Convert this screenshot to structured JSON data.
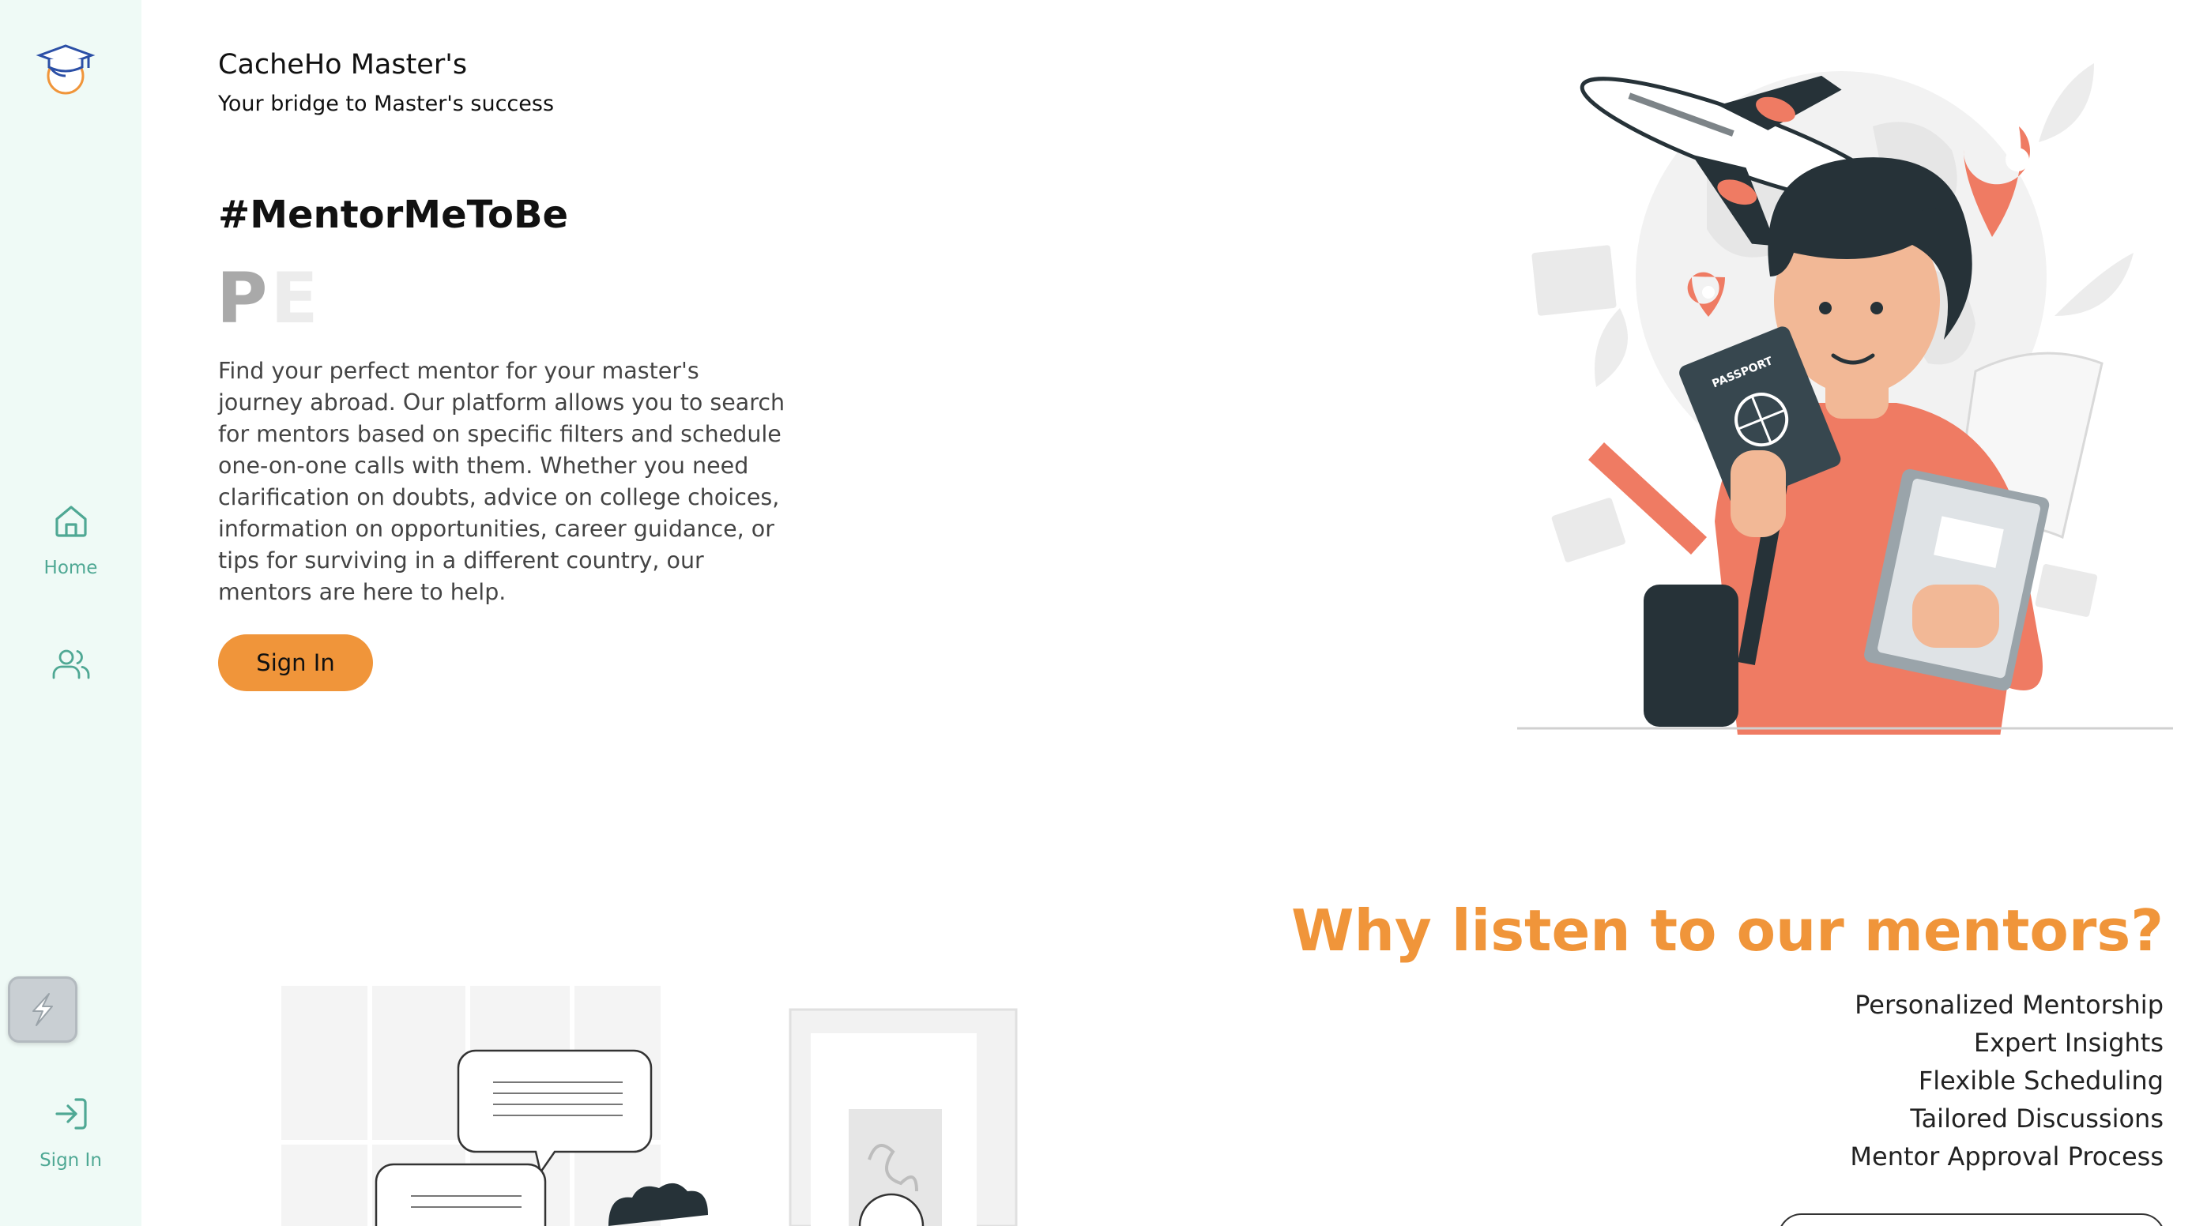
{
  "sidebar": {
    "logo_icon": "graduation-cap-logo-icon",
    "items": [
      {
        "label": "Home",
        "icon": "home-icon"
      },
      {
        "label": "",
        "icon": "users-icon"
      },
      {
        "label": "Sign In",
        "icon": "sign-in-icon"
      }
    ],
    "app_badge_icon": "app-badge-icon"
  },
  "brand": {
    "title": "CacheHo Master's",
    "subtitle": "Your bridge to Master's success"
  },
  "hero": {
    "hashtag": "#MentorMeToBe",
    "typing_text_dark": "P",
    "typing_text_light": "E",
    "description": "Find your perfect mentor for your master's journey abroad. Our platform allows you to search for mentors based on specific filters and schedule one-on-one calls with them. Whether you need clarification on doubts, advice on college choices, information on opportunities, career guidance, or tips for surviving in a different country, our mentors are here to help.",
    "signin_label": "Sign In"
  },
  "why": {
    "title": "Why listen to our mentors?",
    "points": [
      "Personalized Mentorship",
      "Expert Insights",
      "Flexible Scheduling",
      "Tailored Discussions",
      "Mentor Approval Process"
    ]
  },
  "illustration": {
    "passport_text": "PASSPORT"
  },
  "colors": {
    "accent": "#f0953a",
    "sidebar_bg": "#effaf6",
    "sidebar_icon": "#4fa894",
    "illustration_coral": "#ef7b63",
    "illustration_dark": "#263238"
  }
}
